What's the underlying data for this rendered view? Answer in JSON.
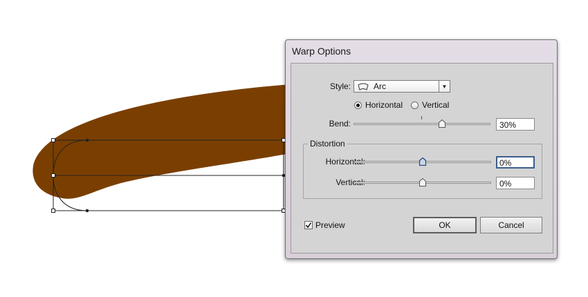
{
  "dialog": {
    "title": "Warp Options",
    "style": {
      "label": "Style:",
      "selected": "Arc",
      "icon": "arc-warp-icon"
    },
    "orientation": {
      "horizontal_label": "Horizontal",
      "vertical_label": "Vertical",
      "selected": "Horizontal"
    },
    "bend": {
      "label": "Bend:",
      "value": "30%",
      "slider_percent": 30
    },
    "distortion": {
      "group_label": "Distortion",
      "horizontal_label": "Horizontal:",
      "horizontal_value": "0%",
      "horizontal_percent": 0,
      "vertical_label": "Vertical:",
      "vertical_value": "0%",
      "vertical_percent": 0
    },
    "preview": {
      "label": "Preview",
      "checked": true
    },
    "ok_label": "OK",
    "cancel_label": "Cancel"
  },
  "colors": {
    "artwork_fill": "#7a3f00",
    "dialog_body": "#d4d4d4",
    "focus_border": "#3c5d8a",
    "thumb_active": "#1f3f7a"
  }
}
